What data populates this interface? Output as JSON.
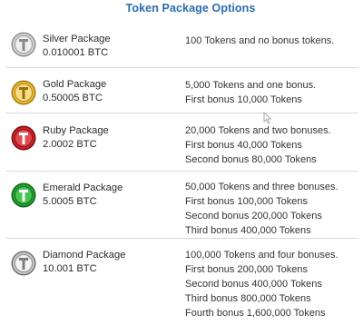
{
  "page": {
    "title": "Token Package Options"
  },
  "colors": {
    "title": "#2a6cb0",
    "silver": "#b8b8b8",
    "gold": "#d9a520",
    "ruby": "#c0161c",
    "emerald": "#1e9a2a",
    "diamond": "#a9a9a9"
  },
  "packages": [
    {
      "name": "Silver Package",
      "price": "0.010001 BTC",
      "icon": "silver-coin-icon",
      "lines": [
        "100 Tokens and no bonus tokens."
      ]
    },
    {
      "name": "Gold Package",
      "price": "0.50005 BTC",
      "icon": "gold-coin-icon",
      "lines": [
        "5,000 Tokens and one bonus.",
        "First bonus 10,000 Tokens"
      ]
    },
    {
      "name": "Ruby Package",
      "price": "2.0002 BTC",
      "icon": "ruby-coin-icon",
      "lines": [
        "20,000 Tokens and two bonuses.",
        "First bonus 40,000 Tokens",
        "Second bonus 80,000 Tokens"
      ]
    },
    {
      "name": "Emerald Package",
      "price": "5.0005 BTC",
      "icon": "emerald-coin-icon",
      "lines": [
        "50,000 Tokens and three bonuses.",
        "First bonus 100,000 Tokens",
        "Second bonus 200,000 Tokens",
        "Third bonus 400,000 Tokens"
      ]
    },
    {
      "name": "Diamond Package",
      "price": "10.001 BTC",
      "icon": "diamond-coin-icon",
      "lines": [
        "100,000 Tokens and four bonuses.",
        "First bonus 200,000 Tokens",
        "Second bonus 400,000 Tokens",
        "Third bonus 800,000 Tokens",
        "Fourth bonus 1,600,000 Tokens"
      ]
    }
  ]
}
